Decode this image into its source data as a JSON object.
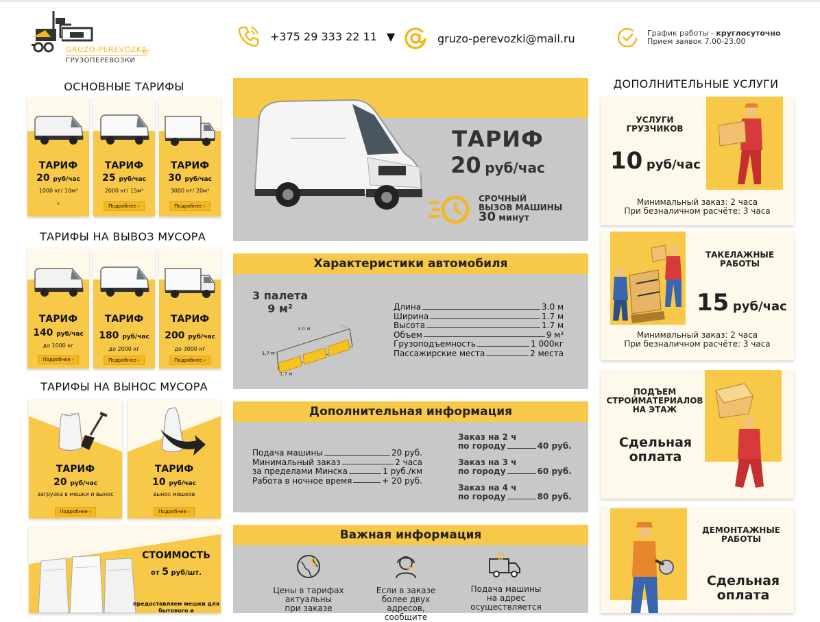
{
  "header": {
    "logo_text": "GRUZO-PEREVOZKA",
    "logo_by": "BY",
    "logo_sub": "ГРУЗОПЕРЕВОЗКИ",
    "phone": "+375 29 333 22 11",
    "email": "gruzo-perevozki@mail.ru",
    "schedule_label": "График работы - ",
    "schedule_value": "круглосуточно",
    "schedule_line2": "Прием заявок 7.00-23.00"
  },
  "colors": {
    "accent": "#f8c948",
    "dark_accent": "#f5b71f",
    "panel_gray": "#c8c8c8",
    "card_bg": "#fff9ec"
  },
  "basic_tariffs": {
    "title": "ОСНОВНЫЕ ТАРИФЫ",
    "items": [
      {
        "title": "ТАРИФ",
        "price": "20",
        "unit": "руб/час",
        "sub": "1000 кг/ 10м³",
        "btn": "›"
      },
      {
        "title": "ТАРИФ",
        "price": "25",
        "unit": "руб/час",
        "sub": "2000 кг/ 15м³",
        "btn": "Подробнее ›"
      },
      {
        "title": "ТАРИФ",
        "price": "30",
        "unit": "руб/час",
        "sub": "3000 кг/ 20м³",
        "btn": "Подробнее ›"
      }
    ]
  },
  "garbage_tariffs": {
    "title": "ТАРИФЫ НА ВЫВОЗ МУСОРА",
    "items": [
      {
        "title": "ТАРИФ",
        "price": "140",
        "unit": "руб/час",
        "sub": "до 1000 кг",
        "btn": "Подробнее ›"
      },
      {
        "title": "ТАРИФ",
        "price": "180",
        "unit": "руб/час",
        "sub": "до 2000 кг",
        "btn": "Подробнее ›"
      },
      {
        "title": "ТАРИФ",
        "price": "200",
        "unit": "руб/час",
        "sub": "до 3000 кг",
        "btn": "Подробнее ›"
      }
    ]
  },
  "removal_tariffs": {
    "title": "ТАРИФЫ НА ВЫНОС МУСОРА",
    "items": [
      {
        "title": "ТАРИФ",
        "price": "20",
        "unit": "руб/час",
        "sub": "загрузка в мешки и вынос",
        "btn": "Подробнее ›"
      },
      {
        "title": "ТАРИФ",
        "price": "10",
        "unit": "руб/час",
        "sub": "вынос мешков",
        "btn": "Подробнее ›"
      }
    ]
  },
  "bags": {
    "title": "СТОИМОСТЬ",
    "price_prefix": "от",
    "price": "5",
    "unit": "руб/шт.",
    "note": "предоставляем мешки для бытового и"
  },
  "main_tariff": {
    "title": "ТАРИФ",
    "price": "20",
    "unit": "руб/час",
    "urgent1": "СРОЧНЫЙ",
    "urgent2": "ВЫЗОВ МАШИНЫ",
    "urgent_time": "30",
    "urgent_unit": "минут"
  },
  "specs": {
    "title": "Характеристики автомобиля",
    "pallets": "3 палета",
    "area": "9 м²",
    "dim_len": "3.0 м",
    "dim_h": "1.7 м",
    "dim_w": "1.7 м",
    "rows": [
      {
        "label": "Длина",
        "value": "3.0 м"
      },
      {
        "label": "Ширина",
        "value": "1.7 м"
      },
      {
        "label": "Высота",
        "value": "1.7 м"
      },
      {
        "label": "Объем",
        "value": "9 м³"
      },
      {
        "label": "Грузоподъемность",
        "value": "1 000кг"
      },
      {
        "label": "Пассажирские места",
        "value": "2 места"
      }
    ]
  },
  "extra_info": {
    "title": "Дополнительная информация",
    "rows": [
      {
        "label": "Подача машины",
        "value": "20 руб."
      },
      {
        "label": "Минимальный заказ",
        "value": "2 часа"
      },
      {
        "label": "за пределами Минска",
        "value": "1 руб./км"
      },
      {
        "label": "Работа в ночное время",
        "value": "+ 20 руб."
      }
    ],
    "orders": [
      {
        "l1": "Заказ на 2 ч",
        "l2": "по городу",
        "value": "40 руб."
      },
      {
        "l1": "Заказ на 3 ч",
        "l2": "по городу",
        "value": "60 руб."
      },
      {
        "l1": "Заказ на 4 ч",
        "l2": "по городу",
        "value": "80 руб."
      }
    ]
  },
  "important": {
    "title": "Важная информация",
    "items": [
      {
        "text1": "Цены в тарифах",
        "text2": "актуальны",
        "text3": "при заказе"
      },
      {
        "text1": "Если в заказе",
        "text2": "более двух",
        "text3": "адресов, сообщите"
      },
      {
        "text1": "Подача машины",
        "text2": "на адрес",
        "text3": "осуществляется"
      }
    ]
  },
  "services": {
    "title": "ДОПОЛНИТЕЛЬНЫЕ УСЛУГИ",
    "loaders": {
      "l1": "УСЛУГИ",
      "l2": "ГРУЗЧИКОВ",
      "price": "10",
      "unit": "руб/час",
      "min1": "Минимальный заказ: 2 часа",
      "min2": "При безналичном расчёте: 3 часа"
    },
    "rigging": {
      "l1": "ТАКЕЛАЖНЫЕ",
      "l2": "РАБОТЫ",
      "price": "15",
      "unit": "руб/час",
      "min1": "Минимальный заказ: 2 часа",
      "min2": "При безналичном расчёте: 3 часа"
    },
    "lift": {
      "l1": "ПОДЪЕМ",
      "l2": "СТРОЙМАТЕРИАЛОВ",
      "l3": "НА ЭТАЖ",
      "big1": "Сдельная",
      "big2": "оплата"
    },
    "demolition": {
      "l1": "ДЕМОНТАЖНЫЕ",
      "l2": "РАБОТЫ",
      "big1": "Сдельная",
      "big2": "оплата"
    }
  }
}
